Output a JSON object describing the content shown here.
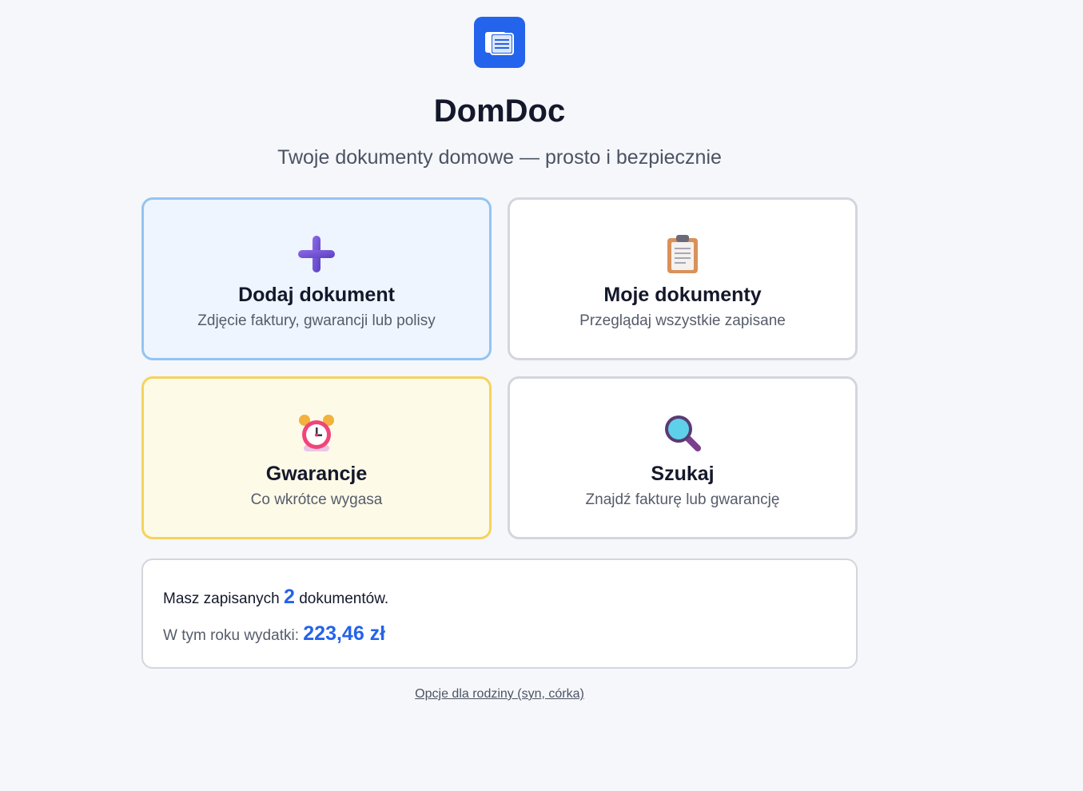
{
  "app": {
    "logo_icon": "document-stack-icon",
    "title": "DomDoc",
    "subtitle": "Twoje dokumenty domowe — prosto i bezpiecznie",
    "brand_color": "#2463eb"
  },
  "tiles": [
    {
      "icon": "plus-icon",
      "label": "Dodaj dokument",
      "desc": "Zdjęcie faktury, gwarancji lub polisy",
      "accent": "#93c4f3"
    },
    {
      "icon": "clipboard-icon",
      "label": "Moje dokumenty",
      "desc": "Przeglądaj wszystkie zapisane",
      "accent": "#d3d6dd"
    },
    {
      "icon": "alarm-clock-icon",
      "label": "Gwarancje",
      "desc": "Co wkrótce wygasa",
      "accent": "#f4d35e"
    },
    {
      "icon": "magnifier-icon",
      "label": "Szukaj",
      "desc": "Znajdź fakturę lub gwarancję",
      "accent": "#d3d6dd"
    }
  ],
  "stats": {
    "docs_prefix": "Masz zapisanych",
    "docs_count": "2",
    "docs_suffix": "dokumentów.",
    "spend_prefix": "W tym roku wydatki:",
    "spend_amount": "223,46 zł"
  },
  "footer": {
    "family_link": "Opcje dla rodziny (syn, córka)"
  }
}
